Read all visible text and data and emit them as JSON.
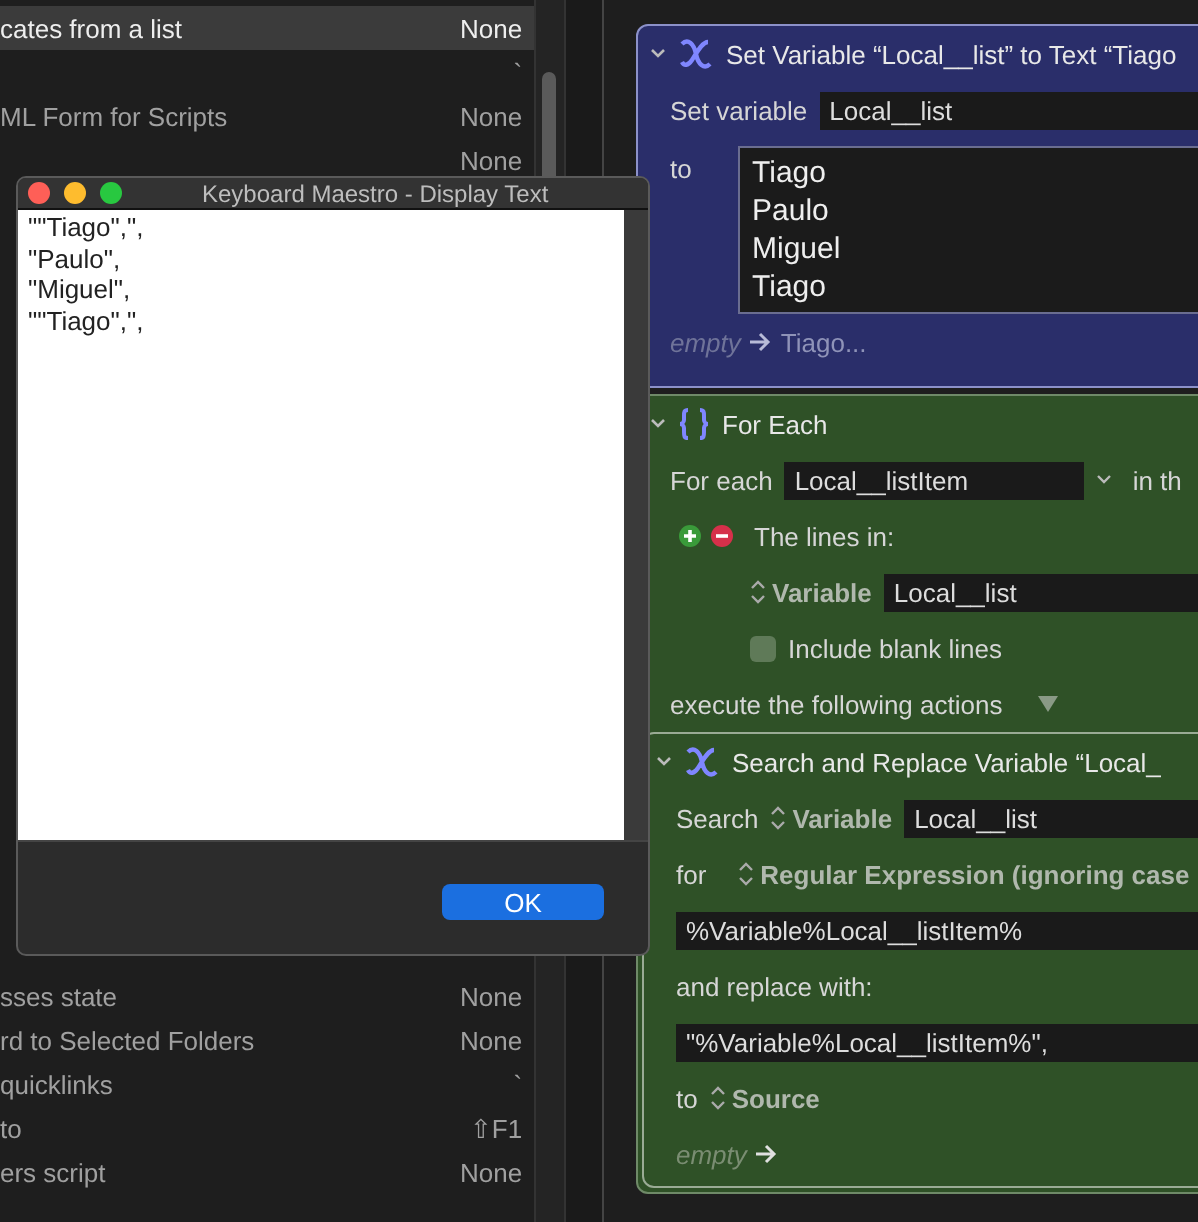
{
  "macro_list": {
    "rows_above": [
      {
        "name": "cates from a list",
        "hotkey": "None",
        "selected": true
      },
      {
        "hotkey": "`",
        "selected": false
      },
      {
        "name": "ML Form for Scripts",
        "hotkey": "None",
        "selected": false
      },
      {
        "hotkey": "None",
        "selected": false
      }
    ],
    "rows_below": [
      {
        "name": "sses state",
        "hotkey": "None",
        "selected": false
      },
      {
        "name": "rd to Selected Folders",
        "hotkey": "None",
        "selected": false
      },
      {
        "name": "quicklinks",
        "hotkey": "`",
        "selected": false
      },
      {
        "name": "to",
        "hotkey": "⇧F1",
        "selected": false
      },
      {
        "name": "ers script",
        "hotkey": "None",
        "selected": false
      }
    ]
  },
  "set_variable_action": {
    "expanded": true,
    "title": "Set Variable “Local__list” to Text “Tiago",
    "variable_label": "Set variable",
    "variable": "Local__list",
    "to_label": "to",
    "text_lines": [
      "Tiago",
      "Paulo",
      "Miguel",
      "Tiago"
    ],
    "summary_empty": "empty",
    "summary_value": "Tiago..."
  },
  "for_each_action": {
    "expanded": true,
    "title": "For Each",
    "for_each_label": "For each",
    "variable": "Local__listItem",
    "in_label": "in th",
    "lines_label": "The lines in:",
    "source_kind": "Variable",
    "source_variable": "Local__list",
    "include_blank_lines": false,
    "include_label": "Include blank lines",
    "execute_label": "execute the following actions",
    "search_replace_action": {
      "expanded": true,
      "title": "Search and Replace Variable “Local_",
      "search_label": "Search",
      "search_kind": "Variable",
      "variable": "Local__list",
      "for_label": "for",
      "match_kind": "Regular Expression (ignoring case",
      "pattern": "%Variable%Local__listItem%",
      "replace_label": "and replace with:",
      "replacement": "\"%Variable%Local__listItem%\",",
      "to_label": "to",
      "destination": "Source",
      "summary_empty": "empty"
    }
  },
  "dialog": {
    "title": "Keyboard Maestro - Display Text",
    "lines": [
      "\"\"Tiago\",\",",
      "\"Paulo\",",
      "\"Miguel\",",
      "\"\"Tiago\",\","
    ],
    "button": "OK"
  }
}
